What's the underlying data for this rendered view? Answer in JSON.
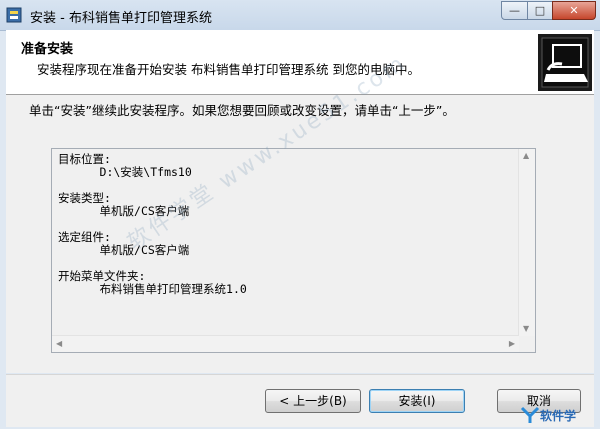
{
  "window": {
    "title": "安装 - 布科销售单打印管理系统",
    "controls": {
      "minimize": "—",
      "maximize": "□",
      "close": "✕"
    }
  },
  "header": {
    "title": "准备安装",
    "subtitle": "安装程序现在准备开始安装 布料销售单打印管理系统 到您的电脑中。",
    "icon": "setup-computer-icon"
  },
  "body": {
    "instruction": "单击“安装”继续此安装程序。如果您想要回顾或改变设置，请单击“上一步”。",
    "memo": "目标位置:\n      D:\\安装\\Tfms10\n\n安装类型:\n      单机版/CS客户端\n\n选定组件:\n      单机版/CS客户端\n\n开始菜单文件夹:\n      布料销售单打印管理系统1.0"
  },
  "footer": {
    "back_label": "< 上一步(B)",
    "install_label": "安装(I)",
    "cancel_label": "取消"
  },
  "watermark": {
    "text": "软件学堂 www.xue51.com",
    "logo_text": "软件学"
  }
}
